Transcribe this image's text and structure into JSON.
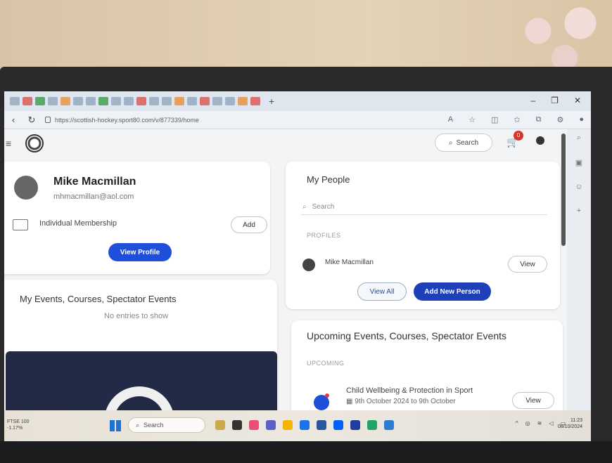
{
  "browser": {
    "url": "https://scottish-hockey.sport80.com/v/877339/home",
    "tab_add": "+",
    "window_controls": [
      "–",
      "❐",
      "✕"
    ]
  },
  "header": {
    "search_label": "Search",
    "cart_count": "0"
  },
  "profile": {
    "name": "Mike Macmillan",
    "email": "mhmacmillan@aol.com",
    "membership": "Individual Membership",
    "add_label": "Add",
    "view_profile_label": "View Profile"
  },
  "my_events": {
    "title": "My Events, Courses, Spectator Events",
    "empty": "No entries to show"
  },
  "my_people": {
    "title": "My People",
    "search_placeholder": "Search",
    "profiles_label": "PROFILES",
    "person_name": "Mike Macmillan",
    "view_label": "View",
    "view_all_label": "View All",
    "add_new_label": "Add New Person"
  },
  "upcoming": {
    "title": "Upcoming Events, Courses, Spectator Events",
    "label": "UPCOMING",
    "event_name": "Child Wellbeing & Protection in Sport",
    "event_dates": "9th October 2024 to 9th October",
    "view_label": "View"
  },
  "taskbar": {
    "ticker_name": "FTSE 100",
    "ticker_change": "-1.17%",
    "search_label": "Search",
    "time": "11:23",
    "date": "08/10/2024"
  },
  "colors": {
    "primary": "#1f4fd8",
    "primary_dark": "#1e3fb8",
    "badge": "#d9342b"
  }
}
